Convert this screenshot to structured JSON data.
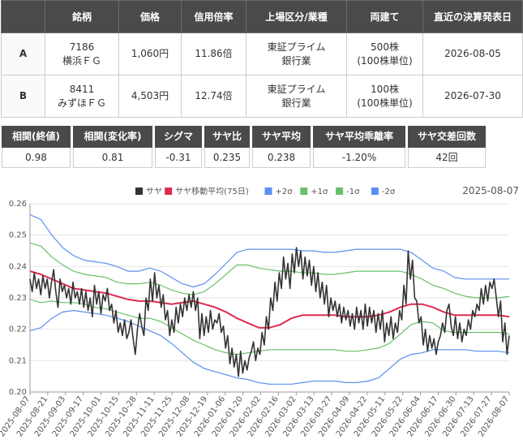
{
  "table": {
    "headers": [
      "",
      "銘柄",
      "価格",
      "信用倍率",
      "上場区分/業種",
      "両建て",
      "直近の決算発表日"
    ],
    "rows": [
      {
        "label": "A",
        "code": "7186",
        "name": "横浜ＦＧ",
        "price": "1,060円",
        "margin_ratio": "11.86倍",
        "market": "東証プライム",
        "industry": "銀行業",
        "hedge": "500株",
        "unit": "(100株単位)",
        "date": "2026-08-05"
      },
      {
        "label": "B",
        "code": "8411",
        "name": "みずほＦＧ",
        "price": "4,503円",
        "margin_ratio": "12.74倍",
        "market": "東証プライム",
        "industry": "銀行業",
        "hedge": "100株",
        "unit": "(100株単位)",
        "date": "2026-07-30"
      }
    ]
  },
  "stats": [
    {
      "label": "相関(終値)",
      "value": "0.98"
    },
    {
      "label": "相関(変化率)",
      "value": "0.81"
    },
    {
      "label": "シグマ",
      "value": "-0.31"
    },
    {
      "label": "サヤ比",
      "value": "0.235"
    },
    {
      "label": "サヤ平均",
      "value": "0.238"
    },
    {
      "label": "サヤ平均乖離率",
      "value": "-1.20%"
    },
    {
      "label": "サヤ交差回数",
      "value": "42回"
    }
  ],
  "chart_data": {
    "type": "line",
    "date_label": "2025-08-07",
    "ylim": [
      0.2,
      0.26
    ],
    "yticks": [
      "0.20",
      "0.21",
      "0.22",
      "0.23",
      "0.24",
      "0.25",
      "0.26"
    ],
    "xticks": [
      "2025-08-07",
      "2025-08-21",
      "2025-09-03",
      "2025-09-17",
      "2025-10-01",
      "2025-10-15",
      "2025-10-28",
      "2025-11-11",
      "2025-11-25",
      "2025-12-08",
      "2025-12-19",
      "2026-01-06",
      "2026-01-20",
      "2026-02-02",
      "2026-02-16",
      "2026-03-02",
      "2026-03-13",
      "2026-03-27",
      "2026-04-09",
      "2026-04-22",
      "2026-05-11",
      "2026-05-22",
      "2026-06-04",
      "2026-06-17",
      "2026-06-30",
      "2026-07-13",
      "2026-07-27",
      "2026-08-07"
    ],
    "series": [
      {
        "name": "サヤ",
        "color": "#333333",
        "values": [
          0.236,
          0.232,
          0.238,
          0.233,
          0.236,
          0.231,
          0.237,
          0.233,
          0.236,
          0.23,
          0.235,
          0.239,
          0.232,
          0.227,
          0.236,
          0.232,
          0.234,
          0.23,
          0.233,
          0.228,
          0.235,
          0.23,
          0.232,
          0.228,
          0.233,
          0.227,
          0.232,
          0.226,
          0.23,
          0.224,
          0.234,
          0.228,
          0.232,
          0.225,
          0.231,
          0.229,
          0.233,
          0.226,
          0.228,
          0.222,
          0.226,
          0.219,
          0.222,
          0.218,
          0.223,
          0.217,
          0.219,
          0.223,
          0.217,
          0.212,
          0.22,
          0.225,
          0.221,
          0.218,
          0.23,
          0.226,
          0.236,
          0.229,
          0.238,
          0.23,
          0.234,
          0.227,
          0.231,
          0.223,
          0.226,
          0.218,
          0.223,
          0.219,
          0.227,
          0.222,
          0.228,
          0.224,
          0.23,
          0.226,
          0.231,
          0.227,
          0.232,
          0.226,
          0.23,
          0.217,
          0.225,
          0.218,
          0.224,
          0.219,
          0.226,
          0.22,
          0.223,
          0.222,
          0.225,
          0.219,
          0.221,
          0.214,
          0.218,
          0.209,
          0.214,
          0.208,
          0.212,
          0.205,
          0.213,
          0.206,
          0.21,
          0.207,
          0.211,
          0.213,
          0.216,
          0.21,
          0.214,
          0.212,
          0.219,
          0.215,
          0.224,
          0.22,
          0.23,
          0.226,
          0.235,
          0.229,
          0.238,
          0.233,
          0.243,
          0.236,
          0.241,
          0.233,
          0.244,
          0.238,
          0.246,
          0.24,
          0.245,
          0.236,
          0.243,
          0.237,
          0.242,
          0.234,
          0.24,
          0.232,
          0.238,
          0.23,
          0.235,
          0.228,
          0.234,
          0.224,
          0.23,
          0.226,
          0.229,
          0.224,
          0.228,
          0.222,
          0.227,
          0.223,
          0.226,
          0.221,
          0.225,
          0.22,
          0.227,
          0.222,
          0.226,
          0.22,
          0.228,
          0.221,
          0.227,
          0.222,
          0.226,
          0.219,
          0.225,
          0.22,
          0.226,
          0.216,
          0.222,
          0.218,
          0.224,
          0.217,
          0.222,
          0.219,
          0.226,
          0.223,
          0.234,
          0.228,
          0.245,
          0.236,
          0.242,
          0.23,
          0.229,
          0.222,
          0.224,
          0.215,
          0.22,
          0.213,
          0.218,
          0.214,
          0.217,
          0.212,
          0.216,
          0.218,
          0.222,
          0.219,
          0.226,
          0.228,
          0.221,
          0.218,
          0.224,
          0.217,
          0.222,
          0.216,
          0.22,
          0.218,
          0.223,
          0.22,
          0.226,
          0.224,
          0.228,
          0.226,
          0.233,
          0.228,
          0.234,
          0.229,
          0.235,
          0.233,
          0.236,
          0.23,
          0.224,
          0.229,
          0.216,
          0.222,
          0.212,
          0.218
        ]
      },
      {
        "name": "サヤ移動平均(75日)",
        "color": "#dd2b4f"
      },
      {
        "name": "+2σ",
        "color": "#5b8ff0"
      },
      {
        "name": "+1σ",
        "color": "#6ac06a"
      },
      {
        "name": "-1σ",
        "color": "#6ac06a"
      },
      {
        "name": "-2σ",
        "color": "#5b8ff0"
      }
    ],
    "band_keys": {
      "ma": [
        0.2385,
        0.2375,
        0.236,
        0.2345,
        0.233,
        0.2325,
        0.232,
        0.2315,
        0.2305,
        0.2295,
        0.229,
        0.229,
        0.2285,
        0.228,
        0.2285,
        0.229,
        0.228,
        0.227,
        0.2255,
        0.2235,
        0.222,
        0.2205,
        0.2205,
        0.2215,
        0.2235,
        0.2245,
        0.2245,
        0.2245,
        0.2245,
        0.224,
        0.224,
        0.224,
        0.2245,
        0.2255,
        0.227,
        0.228,
        0.228,
        0.227,
        0.2255,
        0.2245,
        0.2245,
        0.2245,
        0.2245,
        0.2245,
        0.224
      ],
      "p2": [
        0.2565,
        0.255,
        0.25,
        0.246,
        0.2435,
        0.242,
        0.2415,
        0.241,
        0.24,
        0.2385,
        0.2385,
        0.2395,
        0.2385,
        0.2365,
        0.2345,
        0.2335,
        0.2345,
        0.2375,
        0.241,
        0.2445,
        0.2455,
        0.2455,
        0.2455,
        0.2455,
        0.2455,
        0.245,
        0.245,
        0.2445,
        0.2445,
        0.245,
        0.2455,
        0.2455,
        0.2455,
        0.2455,
        0.2455,
        0.2445,
        0.242,
        0.2395,
        0.2385,
        0.2365,
        0.236,
        0.236,
        0.236,
        0.236,
        0.236
      ],
      "p1": [
        0.2475,
        0.2465,
        0.243,
        0.2405,
        0.2385,
        0.2375,
        0.237,
        0.2365,
        0.235,
        0.2345,
        0.2345,
        0.235,
        0.234,
        0.2325,
        0.2315,
        0.231,
        0.232,
        0.2345,
        0.2375,
        0.2405,
        0.2405,
        0.2395,
        0.239,
        0.2385,
        0.2385,
        0.238,
        0.238,
        0.2375,
        0.2375,
        0.238,
        0.2385,
        0.2385,
        0.2385,
        0.2385,
        0.2385,
        0.2375,
        0.236,
        0.234,
        0.233,
        0.2315,
        0.2305,
        0.23,
        0.23,
        0.23,
        0.2305
      ],
      "m1": [
        0.2295,
        0.2285,
        0.229,
        0.2285,
        0.2285,
        0.228,
        0.227,
        0.2265,
        0.2255,
        0.2245,
        0.2235,
        0.2235,
        0.2225,
        0.2205,
        0.2185,
        0.2165,
        0.215,
        0.2135,
        0.2125,
        0.212,
        0.2125,
        0.213,
        0.2135,
        0.2135,
        0.2135,
        0.2135,
        0.2135,
        0.2135,
        0.2135,
        0.213,
        0.213,
        0.2135,
        0.214,
        0.2155,
        0.2185,
        0.2215,
        0.2225,
        0.222,
        0.2195,
        0.219,
        0.219,
        0.219,
        0.219,
        0.219,
        0.2185
      ],
      "m2": [
        0.2195,
        0.2205,
        0.2235,
        0.2255,
        0.226,
        0.2255,
        0.225,
        0.2245,
        0.2235,
        0.2225,
        0.221,
        0.2195,
        0.218,
        0.2155,
        0.2125,
        0.2095,
        0.2075,
        0.2065,
        0.2055,
        0.2045,
        0.204,
        0.203,
        0.2025,
        0.2025,
        0.2025,
        0.203,
        0.2035,
        0.2035,
        0.2035,
        0.203,
        0.203,
        0.2035,
        0.2045,
        0.2075,
        0.2105,
        0.212,
        0.2125,
        0.2135,
        0.2135,
        0.2135,
        0.2135,
        0.213,
        0.213,
        0.213,
        0.2125
      ]
    }
  }
}
